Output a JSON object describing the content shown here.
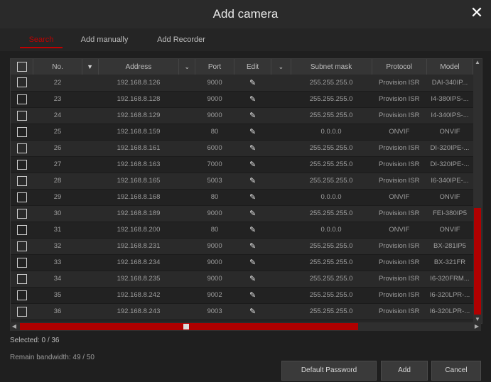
{
  "window": {
    "title": "Add camera",
    "close_glyph": "✕"
  },
  "tabs": [
    {
      "label": "Search",
      "active": true
    },
    {
      "label": "Add manually",
      "active": false
    },
    {
      "label": "Add Recorder",
      "active": false
    }
  ],
  "table": {
    "columns": [
      "",
      "No.",
      "▼",
      "Address",
      "⌄",
      "Port",
      "Edit",
      "⌄",
      "Subnet mask",
      "Protocol",
      "Model"
    ],
    "rows": [
      {
        "no": "22",
        "address": "192.168.8.126",
        "port": "9000",
        "subnet": "255.255.255.0",
        "protocol": "Provision ISR",
        "model": "DAI-340IP..."
      },
      {
        "no": "23",
        "address": "192.168.8.128",
        "port": "9000",
        "subnet": "255.255.255.0",
        "protocol": "Provision ISR",
        "model": "I4-380IPS-..."
      },
      {
        "no": "24",
        "address": "192.168.8.129",
        "port": "9000",
        "subnet": "255.255.255.0",
        "protocol": "Provision ISR",
        "model": "I4-340IPS-..."
      },
      {
        "no": "25",
        "address": "192.168.8.159",
        "port": "80",
        "subnet": "0.0.0.0",
        "protocol": "ONVIF",
        "model": "ONVIF"
      },
      {
        "no": "26",
        "address": "192.168.8.161",
        "port": "6000",
        "subnet": "255.255.255.0",
        "protocol": "Provision ISR",
        "model": "DI-320IPE-..."
      },
      {
        "no": "27",
        "address": "192.168.8.163",
        "port": "7000",
        "subnet": "255.255.255.0",
        "protocol": "Provision ISR",
        "model": "DI-320IPE-..."
      },
      {
        "no": "28",
        "address": "192.168.8.165",
        "port": "5003",
        "subnet": "255.255.255.0",
        "protocol": "Provision ISR",
        "model": "I6-340IPE-..."
      },
      {
        "no": "29",
        "address": "192.168.8.168",
        "port": "80",
        "subnet": "0.0.0.0",
        "protocol": "ONVIF",
        "model": "ONVIF"
      },
      {
        "no": "30",
        "address": "192.168.8.189",
        "port": "9000",
        "subnet": "255.255.255.0",
        "protocol": "Provision ISR",
        "model": "FEI-380IP5"
      },
      {
        "no": "31",
        "address": "192.168.8.200",
        "port": "80",
        "subnet": "0.0.0.0",
        "protocol": "ONVIF",
        "model": "ONVIF"
      },
      {
        "no": "32",
        "address": "192.168.8.231",
        "port": "9000",
        "subnet": "255.255.255.0",
        "protocol": "Provision ISR",
        "model": "BX-281IP5"
      },
      {
        "no": "33",
        "address": "192.168.8.234",
        "port": "9000",
        "subnet": "255.255.255.0",
        "protocol": "Provision ISR",
        "model": "BX-321FR"
      },
      {
        "no": "34",
        "address": "192.168.8.235",
        "port": "9000",
        "subnet": "255.255.255.0",
        "protocol": "Provision ISR",
        "model": "I6-320FRM..."
      },
      {
        "no": "35",
        "address": "192.168.8.242",
        "port": "9002",
        "subnet": "255.255.255.0",
        "protocol": "Provision ISR",
        "model": "I6-320LPR-..."
      },
      {
        "no": "36",
        "address": "192.168.8.243",
        "port": "9003",
        "subnet": "255.255.255.0",
        "protocol": "Provision ISR",
        "model": "I6-320LPR-..."
      }
    ],
    "edit_glyph": "✎",
    "vscroll_up": "▲",
    "vscroll_down": "▼",
    "hscroll_left": "◀",
    "hscroll_right": "▶"
  },
  "status": {
    "selected": "Selected: 0 / 36",
    "bandwidth": "Remain bandwidth: 49 / 50"
  },
  "buttons": {
    "default_password": "Default Password",
    "add": "Add",
    "cancel": "Cancel"
  },
  "colors": {
    "accent": "#c00000"
  }
}
